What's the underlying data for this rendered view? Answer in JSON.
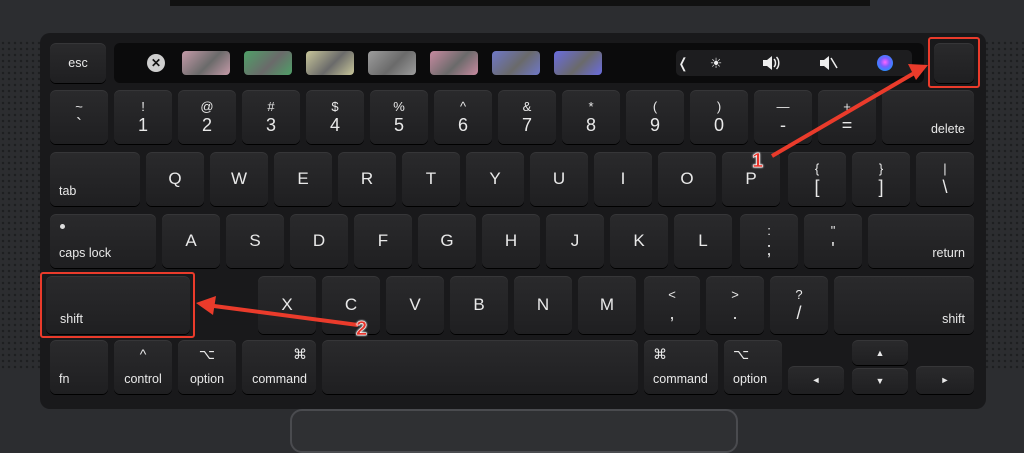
{
  "colors": {
    "annotation": "#ea3b2b",
    "key": "#202022",
    "deck": "#19191b",
    "chassis": "#2c2d30"
  },
  "touchbar": {
    "close_symbol": "✕",
    "thumb_colors": [
      "#c49aa8",
      "#4fa068",
      "#c8c69a",
      "#9d9d9d",
      "#c78aa0",
      "#6f78c8",
      "#6a6ce0"
    ],
    "chevron": "❬",
    "brightness_icon": "☀",
    "volume_icon": "🔊",
    "mute_icon": "🔇",
    "siri_icon": "siri-icon",
    "touch_id_key": "touch-id-key"
  },
  "keys": {
    "esc": "esc",
    "number_row": [
      {
        "top": "~",
        "bottom": "`"
      },
      {
        "top": "!",
        "bottom": "1"
      },
      {
        "top": "@",
        "bottom": "2"
      },
      {
        "top": "#",
        "bottom": "3"
      },
      {
        "top": "$",
        "bottom": "4"
      },
      {
        "top": "%",
        "bottom": "5"
      },
      {
        "top": "^",
        "bottom": "6"
      },
      {
        "top": "&",
        "bottom": "7"
      },
      {
        "top": "*",
        "bottom": "8"
      },
      {
        "top": "(",
        "bottom": "9"
      },
      {
        "top": ")",
        "bottom": "0"
      },
      {
        "top": "—",
        "bottom": "-"
      },
      {
        "top": "+",
        "bottom": "="
      }
    ],
    "delete": "delete",
    "tab": "tab",
    "qwerty_row": [
      "Q",
      "W",
      "E",
      "R",
      "T",
      "Y",
      "U",
      "I",
      "O",
      "P"
    ],
    "brace_open": {
      "top": "{",
      "bottom": "["
    },
    "brace_close": {
      "top": "}",
      "bottom": "]"
    },
    "pipe": {
      "top": "|",
      "bottom": "\\"
    },
    "caps_lock": "caps lock",
    "home_row": [
      "A",
      "S",
      "D",
      "F",
      "G",
      "H",
      "J",
      "K",
      "L"
    ],
    "colon": {
      "top": ":",
      "bottom": ";"
    },
    "quote": {
      "top": "\"",
      "bottom": "'"
    },
    "return": "return",
    "shift_left": "shift",
    "bottom_letters": [
      "X",
      "C",
      "V",
      "B",
      "N",
      "M"
    ],
    "lt": {
      "top": "<",
      "bottom": ","
    },
    "gt": {
      "top": ">",
      "bottom": "."
    },
    "question": {
      "top": "?",
      "bottom": "/"
    },
    "shift_right": "shift",
    "fn": "fn",
    "control": {
      "symbol": "^",
      "label": "control"
    },
    "option_left": {
      "symbol": "⌥",
      "label": "option"
    },
    "command_left": {
      "symbol": "⌘",
      "label": "command"
    },
    "command_right": {
      "symbol": "⌘",
      "label": "command"
    },
    "option_right": {
      "symbol": "⌥",
      "label": "option"
    },
    "arrow_up": "▲",
    "arrow_left": "◄",
    "arrow_down": "▼",
    "arrow_right": "►"
  },
  "annotations": {
    "marker_1": "1",
    "marker_2": "2"
  }
}
